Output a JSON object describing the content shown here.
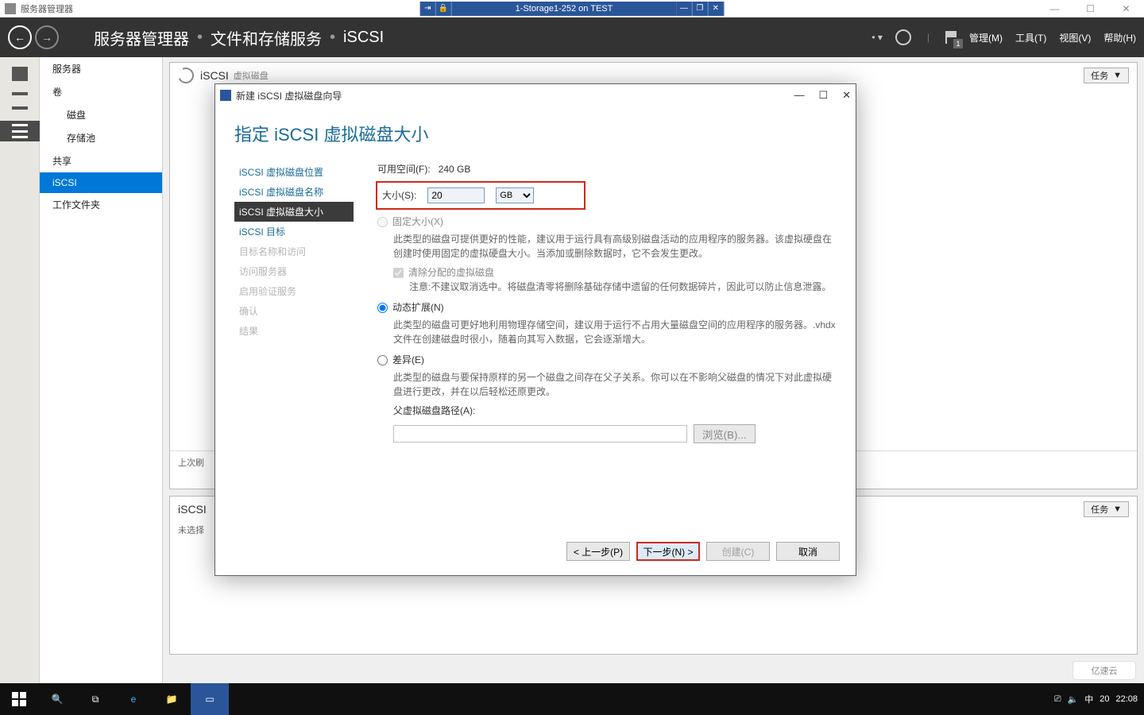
{
  "outer": {
    "app_name": "服务器管理器",
    "vm_name": "1-Storage1-252 on TEST"
  },
  "header": {
    "bc1": "服务器管理器",
    "bc2": "文件和存储服务",
    "bc3": "iSCSI",
    "menu_manage": "管理(M)",
    "menu_tools": "工具(T)",
    "menu_view": "视图(V)",
    "menu_help": "帮助(H)",
    "flag_count": "1"
  },
  "nav": {
    "servers": "服务器",
    "volumes": "卷",
    "disks": "磁盘",
    "pools": "存储池",
    "shares": "共享",
    "iscsi": "iSCSI",
    "workfolders": "工作文件夹"
  },
  "tiles": {
    "iscsi_title": "iSCSI",
    "iscsi_sub": "虚拟磁盘",
    "tasks": "任务",
    "last": "上次刷",
    "target_title": "iSCSI",
    "target_sub": "未选择"
  },
  "wizard": {
    "title": "新建 iSCSI 虚拟磁盘向导",
    "heading": "指定 iSCSI 虚拟磁盘大小",
    "steps": {
      "loc": "iSCSI 虚拟磁盘位置",
      "name": "iSCSI 虚拟磁盘名称",
      "size": "iSCSI 虚拟磁盘大小",
      "target": "iSCSI 目标",
      "tname": "目标名称和访问",
      "access": "访问服务器",
      "auth": "启用验证服务",
      "confirm": "确认",
      "result": "结果"
    },
    "avail_lbl": "可用空间(F):",
    "avail_val": "240 GB",
    "size_lbl": "大小(S):",
    "size_val": "20",
    "unit": "GB",
    "fixed": "固定大小(X)",
    "fixed_desc": "此类型的磁盘可提供更好的性能，建议用于运行具有高级别磁盘活动的应用程序的服务器。该虚拟硬盘在创建时使用固定的虚拟硬盘大小。当添加或删除数据时，它不会发生更改。",
    "clear": "清除分配的虚拟磁盘",
    "clear_desc": "注意:不建议取消选中。将磁盘清零将删除基础存储中遗留的任何数据碎片，因此可以防止信息泄露。",
    "dyn": "动态扩展(N)",
    "dyn_desc": "此类型的磁盘可更好地利用物理存储空间，建议用于运行不占用大量磁盘空间的应用程序的服务器。.vhdx 文件在创建磁盘时很小，随着向其写入数据，它会逐渐增大。",
    "diff": "差异(E)",
    "diff_desc": "此类型的磁盘与要保持原样的另一个磁盘之间存在父子关系。你可以在不影响父磁盘的情况下对此虚拟硬盘进行更改，并在以后轻松还原更改。",
    "parent_lbl": "父虚拟磁盘路径(A):",
    "browse": "浏览(B)...",
    "prev": "< 上一步(P)",
    "next": "下一步(N) >",
    "create": "创建(C)",
    "cancel": "取消"
  },
  "taskbar": {
    "ime": "中",
    "time": "22:08",
    "vol": "20"
  },
  "watermark": "亿速云"
}
